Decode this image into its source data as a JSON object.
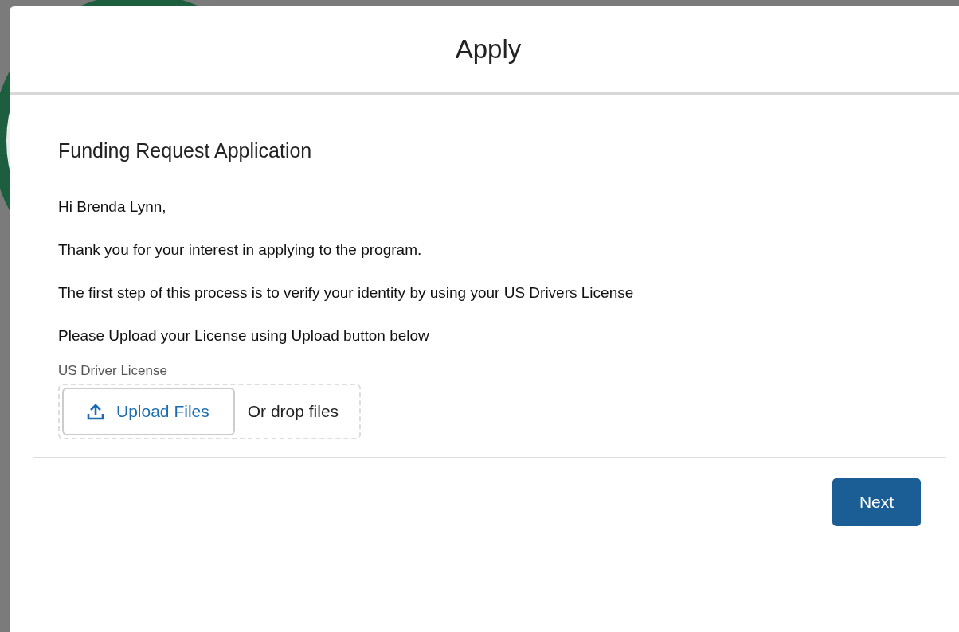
{
  "modal": {
    "title": "Apply"
  },
  "form": {
    "heading": "Funding Request Application",
    "paragraphs": [
      "Hi Brenda Lynn,",
      "Thank you for your interest in applying to the program.",
      "The first step of this process is to verify your identity by using your US Drivers License",
      "Please Upload your License using Upload button below"
    ],
    "upload": {
      "label": "US Driver License",
      "button": "Upload Files",
      "drop_text": "Or drop files"
    }
  },
  "footer": {
    "button": "Next"
  }
}
